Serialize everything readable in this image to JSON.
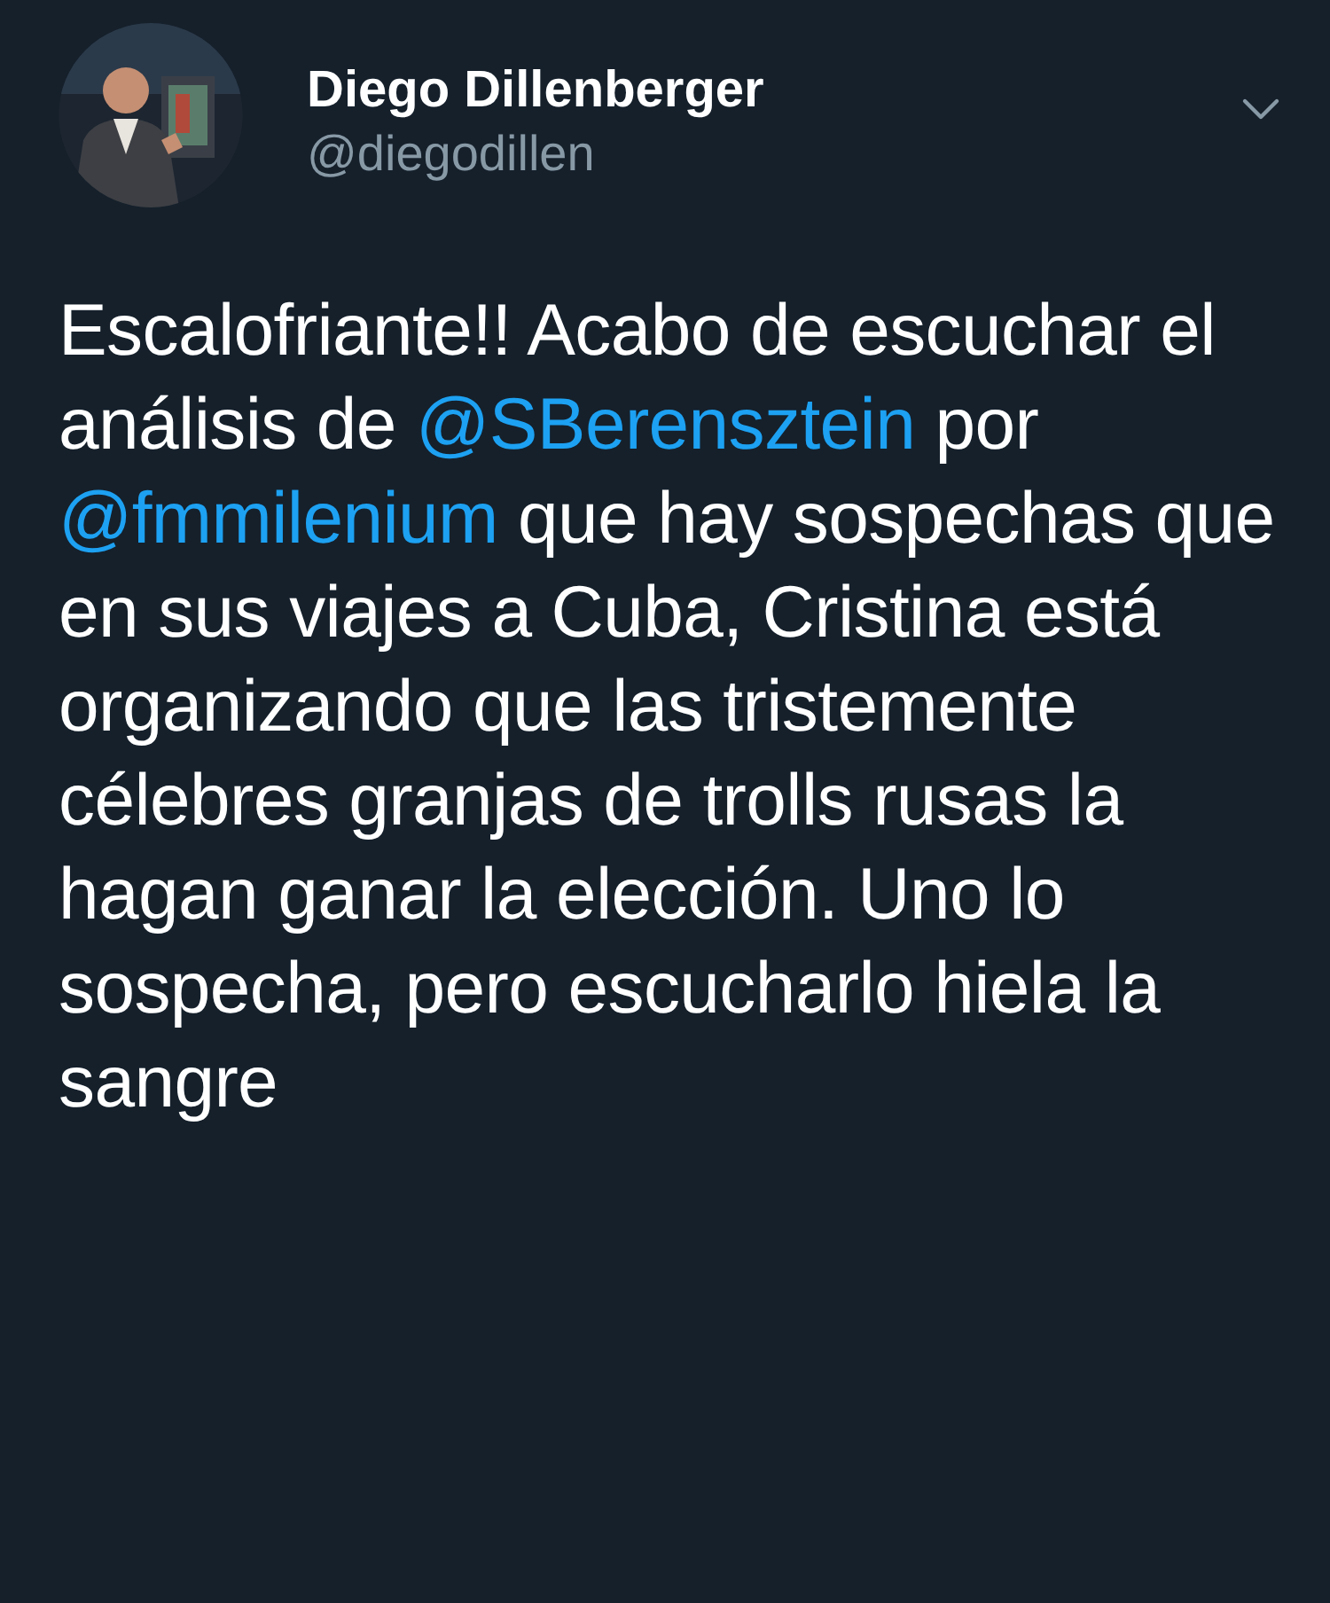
{
  "author": {
    "name": "Diego Dillenberger",
    "handle": "@diegodillen"
  },
  "tweet": [
    {
      "kind": "text",
      "text": "Escalofriante!! Acabo de escuchar el análisis de "
    },
    {
      "kind": "mention",
      "text": "@SBerensztein"
    },
    {
      "kind": "text",
      "text": " por "
    },
    {
      "kind": "mention",
      "text": "@fmmilenium"
    },
    {
      "kind": "text",
      "text": " que hay sospechas que en sus viajes a Cuba, Cristina está organizando que las tristemente célebres granjas de trolls rusas la hagan ganar la elección. Uno lo sospecha, pero escucharlo hiela la sangre"
    }
  ]
}
